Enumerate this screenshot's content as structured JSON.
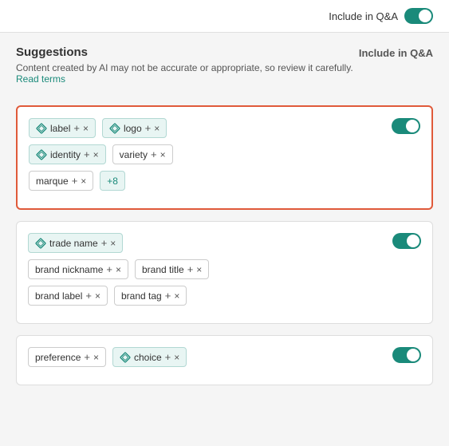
{
  "topbar": {
    "toggle_label": "Include in Q&A",
    "toggle_enabled": true
  },
  "suggestions": {
    "title": "Suggestions",
    "description": "Content created by AI may not be accurate or appropriate, so review it carefully.",
    "read_terms_label": "Read terms",
    "qna_column_label": "Include in Q&A"
  },
  "cards": [
    {
      "id": "card1",
      "highlighted": true,
      "toggle_enabled": true,
      "rows": [
        [
          {
            "text": "label",
            "type": "teal",
            "has_icon": true,
            "has_plus": true,
            "has_x": true
          },
          {
            "text": "logo",
            "type": "teal",
            "has_icon": true,
            "has_plus": true,
            "has_x": true
          }
        ],
        [
          {
            "text": "identity",
            "type": "teal",
            "has_icon": true,
            "has_plus": true,
            "has_x": true
          },
          {
            "text": "variety",
            "type": "plain",
            "has_icon": false,
            "has_plus": true,
            "has_x": true
          }
        ],
        [
          {
            "text": "marque",
            "type": "plain",
            "has_icon": false,
            "has_plus": true,
            "has_x": true
          },
          {
            "text": "+8",
            "type": "more",
            "has_icon": false,
            "has_plus": false,
            "has_x": false
          }
        ]
      ]
    },
    {
      "id": "card2",
      "highlighted": false,
      "toggle_enabled": true,
      "rows": [
        [
          {
            "text": "trade name",
            "type": "teal",
            "has_icon": true,
            "has_plus": true,
            "has_x": true
          }
        ],
        [
          {
            "text": "brand nickname",
            "type": "plain",
            "has_icon": false,
            "has_plus": true,
            "has_x": true
          },
          {
            "text": "brand title",
            "type": "plain",
            "has_icon": false,
            "has_plus": true,
            "has_x": true
          }
        ],
        [
          {
            "text": "brand label",
            "type": "plain",
            "has_icon": false,
            "has_plus": true,
            "has_x": true
          },
          {
            "text": "brand tag",
            "type": "plain",
            "has_icon": false,
            "has_plus": true,
            "has_x": true
          }
        ]
      ]
    },
    {
      "id": "card3",
      "highlighted": false,
      "toggle_enabled": true,
      "rows": [
        [
          {
            "text": "preference",
            "type": "plain",
            "has_icon": false,
            "has_plus": true,
            "has_x": true
          },
          {
            "text": "choice",
            "type": "teal",
            "has_icon": true,
            "has_plus": true,
            "has_x": true
          }
        ]
      ]
    }
  ]
}
